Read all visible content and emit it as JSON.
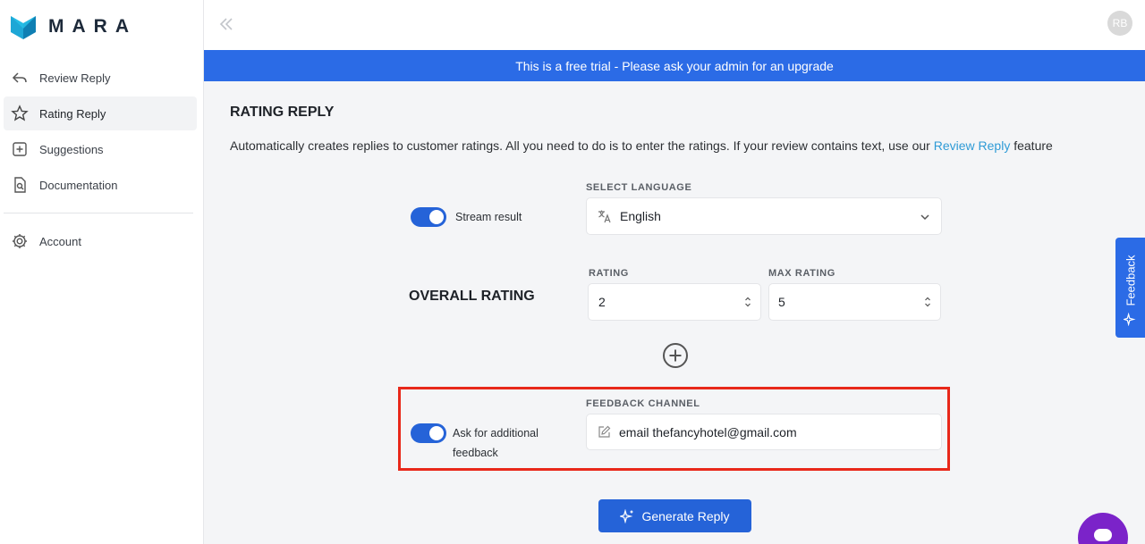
{
  "app": {
    "logo_text": "MARA",
    "avatar_initials": "RB"
  },
  "sidebar": {
    "items": [
      {
        "label": "Review Reply",
        "icon": "reply-icon"
      },
      {
        "label": "Rating Reply",
        "icon": "star-icon",
        "active": true
      },
      {
        "label": "Suggestions",
        "icon": "plus-square-icon"
      },
      {
        "label": "Documentation",
        "icon": "document-icon"
      }
    ],
    "account": {
      "label": "Account",
      "icon": "gear-icon"
    }
  },
  "banner": {
    "text": "This is a free trial - Please ask your admin for an upgrade"
  },
  "main": {
    "title": "RATING REPLY",
    "description_prefix": "Automatically creates replies to customer ratings. All you need to do is to enter the ratings. If your review contains text, use our ",
    "description_link": "Review Reply",
    "description_suffix": " feature",
    "stream": {
      "label": "Stream result",
      "on": true
    },
    "language": {
      "label": "SELECT LANGUAGE",
      "value": "English"
    },
    "overall": {
      "title": "OVERALL RATING",
      "rating_label": "RATING",
      "rating_value": "2",
      "max_label": "MAX RATING",
      "max_value": "5"
    },
    "feedback": {
      "toggle_label_line1": "Ask for additional",
      "toggle_label_line2": "feedback",
      "on": true,
      "channel_label": "FEEDBACK CHANNEL",
      "channel_value": "email thefancyhotel@gmail.com"
    },
    "generate_label": "Generate Reply"
  },
  "feedback_tab": {
    "label": "Feedback"
  },
  "colors": {
    "primary": "#2563d8",
    "banner": "#2b6be6",
    "link": "#2f9bd6",
    "highlight": "#e8281a",
    "chat": "#7b23c9"
  }
}
